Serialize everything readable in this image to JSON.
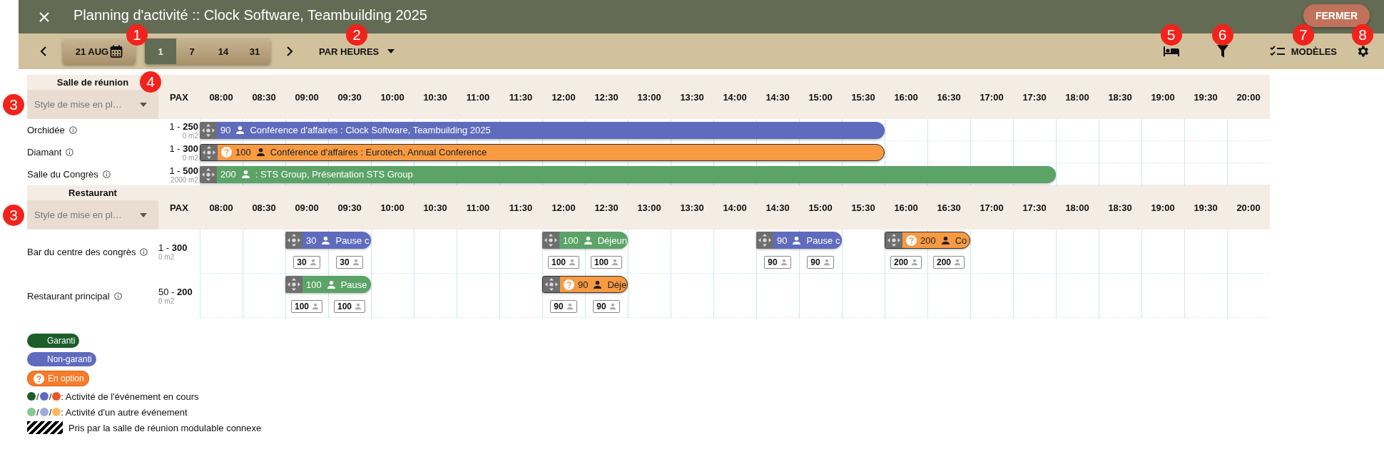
{
  "header": {
    "title": "Planning d'activité :: Clock Software, Teambuilding 2025",
    "close_label": "FERMER"
  },
  "toolbar": {
    "date": "21 AUG",
    "zoom_callout": "1",
    "zoom_options": [
      {
        "label": "1",
        "selected": true
      },
      {
        "label": "7",
        "selected": false
      },
      {
        "label": "14",
        "selected": false
      },
      {
        "label": "31",
        "selected": false
      }
    ],
    "view_mode": {
      "label": "PAR HEURES",
      "callout": "2"
    },
    "tools": [
      {
        "kind": "rooms",
        "callout": "5"
      },
      {
        "kind": "filter",
        "callout": "6"
      },
      {
        "kind": "templates",
        "label": "MODÈLES",
        "callout": "7"
      },
      {
        "kind": "settings",
        "callout": "8"
      }
    ]
  },
  "sections": [
    {
      "title": "Salle de réunion",
      "title_callout": "4",
      "layout_select": {
        "value": "Style de mise en pl…",
        "callout": "3"
      },
      "pax_heading": "PAX",
      "times": [
        "08:00",
        "08:30",
        "09:00",
        "09:30",
        "10:00",
        "10:30",
        "11:00",
        "11:30",
        "12:00",
        "12:30",
        "13:00",
        "13:30",
        "14:00",
        "14:30",
        "15:00",
        "15:30",
        "16:00",
        "16:30",
        "17:00",
        "17:30",
        "18:00",
        "18:30",
        "19:00",
        "19:30",
        "20:00"
      ],
      "rooms": [
        {
          "name": "Orchidée",
          "pax": "1 - **250**",
          "area": "0 m2",
          "cells": [
            {
              "kind": "booked",
              "booking": {
                "kind": "non_guaranteed",
                "count": "90",
                "label": "Conférence d'affaires : Clock Software, Teambuilding 2025"
              }
            },
            {
              "kind": "booked"
            },
            {
              "kind": "booked"
            },
            {
              "kind": "booked"
            },
            {
              "kind": "booked"
            },
            {
              "kind": "booked"
            },
            {
              "kind": "booked"
            },
            {
              "kind": "booked"
            },
            {
              "kind": "booked"
            },
            {
              "kind": "booked"
            },
            {
              "kind": "booked"
            },
            {
              "kind": "booked"
            },
            {
              "kind": "booked"
            },
            {
              "kind": "booked"
            },
            {
              "kind": "booked"
            },
            {
              "kind": "booked"
            },
            {
              "kind": "free"
            },
            {
              "kind": "free"
            },
            {
              "kind": "free"
            },
            {
              "kind": "free"
            },
            {
              "kind": "free"
            },
            {
              "kind": "free"
            },
            {
              "kind": "free"
            },
            {
              "kind": "free"
            },
            {
              "kind": "free"
            }
          ]
        },
        {
          "name": "Diamant",
          "pax": "1 - **300**",
          "area": "0 m2",
          "cells": [
            {
              "kind": "booked",
              "booking": {
                "kind": "option",
                "count": "100",
                "label": "Conférence d'affaires : Eurotech, Annual Conference"
              }
            },
            {
              "kind": "booked"
            },
            {
              "kind": "booked"
            },
            {
              "kind": "booked"
            },
            {
              "kind": "booked"
            },
            {
              "kind": "booked"
            },
            {
              "kind": "booked"
            },
            {
              "kind": "booked"
            },
            {
              "kind": "booked"
            },
            {
              "kind": "booked"
            },
            {
              "kind": "booked"
            },
            {
              "kind": "booked"
            },
            {
              "kind": "booked"
            },
            {
              "kind": "booked"
            },
            {
              "kind": "booked"
            },
            {
              "kind": "booked"
            },
            {
              "kind": "free"
            },
            {
              "kind": "free"
            },
            {
              "kind": "free"
            },
            {
              "kind": "free"
            },
            {
              "kind": "free"
            },
            {
              "kind": "free"
            },
            {
              "kind": "free"
            },
            {
              "kind": "free"
            },
            {
              "kind": "free"
            }
          ]
        },
        {
          "name": "Salle du Congrès",
          "pax": "1 - **500**",
          "area": "2000 m2",
          "cells": [
            {
              "kind": "booked",
              "booking": {
                "kind": "guaranteed",
                "count": "200",
                "label": ": STS Group, Présentation STS Group"
              }
            },
            {
              "kind": "booked"
            },
            {
              "kind": "booked"
            },
            {
              "kind": "booked"
            },
            {
              "kind": "booked"
            },
            {
              "kind": "booked"
            },
            {
              "kind": "booked"
            },
            {
              "kind": "booked"
            },
            {
              "kind": "booked"
            },
            {
              "kind": "booked"
            },
            {
              "kind": "booked"
            },
            {
              "kind": "booked"
            },
            {
              "kind": "booked"
            },
            {
              "kind": "booked"
            },
            {
              "kind": "booked"
            },
            {
              "kind": "booked"
            },
            {
              "kind": "booked"
            },
            {
              "kind": "booked"
            },
            {
              "kind": "booked"
            },
            {
              "kind": "booked"
            },
            {
              "kind": "free"
            },
            {
              "kind": "free"
            },
            {
              "kind": "free"
            },
            {
              "kind": "free"
            },
            {
              "kind": "free"
            }
          ]
        }
      ]
    },
    {
      "title": "Restaurant",
      "layout_select": {
        "value": "Style de mise en pl…",
        "callout": "3"
      },
      "pax_heading": "PAX",
      "times": [
        "08:00",
        "08:30",
        "09:00",
        "09:30",
        "10:00",
        "10:30",
        "11:00",
        "11:30",
        "12:00",
        "12:30",
        "13:00",
        "13:30",
        "14:00",
        "14:30",
        "15:00",
        "15:30",
        "16:00",
        "16:30",
        "17:00",
        "17:30",
        "18:00",
        "18:30",
        "19:00",
        "19:30",
        "20:00"
      ],
      "rooms": [
        {
          "name": "Bar du centre des congrès",
          "pax": "1 - **300**",
          "area": "0 m2",
          "cells": [
            {
              "kind": "free"
            },
            {
              "kind": "free"
            },
            {
              "kind": "booked",
              "slot": "30",
              "booking": {
                "kind": "non_guaranteed",
                "count": "30",
                "label": "Pause c"
              }
            },
            {
              "kind": "booked",
              "slot": "30"
            },
            {
              "kind": "free"
            },
            {
              "kind": "free"
            },
            {
              "kind": "free"
            },
            {
              "kind": "free"
            },
            {
              "kind": "booked",
              "slot": "100",
              "booking": {
                "kind": "guaranteed",
                "count": "100",
                "label": "Déjeun"
              }
            },
            {
              "kind": "booked",
              "slot": "100"
            },
            {
              "kind": "free"
            },
            {
              "kind": "free"
            },
            {
              "kind": "free"
            },
            {
              "kind": "booked",
              "slot": "90",
              "booking": {
                "kind": "non_guaranteed",
                "count": "90",
                "label": "Pause c"
              }
            },
            {
              "kind": "booked",
              "slot": "90"
            },
            {
              "kind": "free"
            },
            {
              "kind": "booked",
              "slot": "200",
              "booking": {
                "kind": "option",
                "count": "200",
                "label": "Co"
              }
            },
            {
              "kind": "booked",
              "slot": "200"
            },
            {
              "kind": "free"
            },
            {
              "kind": "free"
            },
            {
              "kind": "free"
            },
            {
              "kind": "free"
            },
            {
              "kind": "free"
            },
            {
              "kind": "free"
            },
            {
              "kind": "free"
            }
          ]
        },
        {
          "name": "Restaurant principal",
          "pax": "50 - **200**",
          "area": "0 m2",
          "cells": [
            {
              "kind": "free"
            },
            {
              "kind": "free"
            },
            {
              "kind": "booked",
              "slot": "100",
              "booking": {
                "kind": "guaranteed",
                "count": "100",
                "label": "Pause"
              }
            },
            {
              "kind": "booked",
              "slot": "100"
            },
            {
              "kind": "free"
            },
            {
              "kind": "free"
            },
            {
              "kind": "free"
            },
            {
              "kind": "free"
            },
            {
              "kind": "booked",
              "slot": "90",
              "booking": {
                "kind": "option",
                "count": "90",
                "label": "Déje"
              }
            },
            {
              "kind": "booked",
              "slot": "90"
            },
            {
              "kind": "free"
            },
            {
              "kind": "free"
            },
            {
              "kind": "free"
            },
            {
              "kind": "free"
            },
            {
              "kind": "free"
            },
            {
              "kind": "free"
            },
            {
              "kind": "free"
            },
            {
              "kind": "free"
            },
            {
              "kind": "free"
            },
            {
              "kind": "free"
            },
            {
              "kind": "free"
            },
            {
              "kind": "free"
            },
            {
              "kind": "free"
            },
            {
              "kind": "free"
            },
            {
              "kind": "free"
            }
          ]
        }
      ]
    }
  ],
  "legend": {
    "statuses": [
      {
        "kind": "guaranteed",
        "label": "Garanti"
      },
      {
        "kind": "non_guaranteed",
        "label": "Non-garanti"
      },
      {
        "kind": "option",
        "label": "En option"
      }
    ],
    "lines": [
      {
        "kind": "dots",
        "dots": [
          {
            "color": "#1b5e2a"
          },
          {
            "color": "#5f6bbd"
          },
          {
            "color": "#e8572a"
          }
        ],
        "separator": "/",
        "text": ": Activité de l'événement en cours"
      },
      {
        "kind": "dots",
        "dots": [
          {
            "color": "#85c98f"
          },
          {
            "color": "#a3a8d8"
          },
          {
            "color": "#fdb862"
          }
        ],
        "separator": "/",
        "text": ": Activité d'un autre événement"
      },
      {
        "kind": "hatch",
        "text": "Pris par la salle de réunion modulable connexe"
      }
    ]
  }
}
